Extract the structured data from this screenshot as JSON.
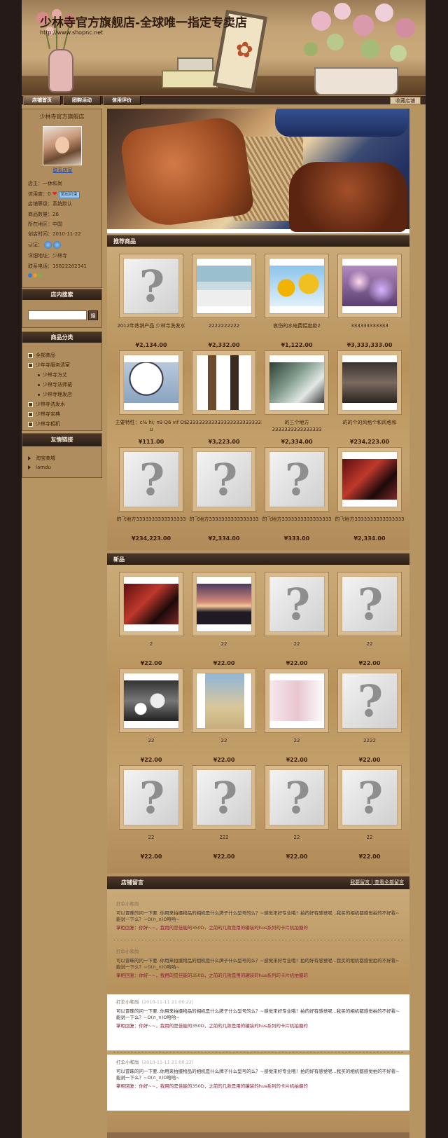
{
  "header": {
    "shop_title": "少林寺官方旗舰店-全球唯一指定专卖店",
    "shop_url": "http://www.shopnc.net"
  },
  "nav": {
    "tabs": [
      "店铺首页",
      "团购活动",
      "信用评价"
    ],
    "favorite_label": "收藏店铺"
  },
  "sidebar": {
    "shop_name": "少林寺官方旗舰店",
    "contact_link": "联系店家",
    "owner": "店主：一休和尚",
    "credit_label": "信用度：0",
    "credit_badge": "宽松约束",
    "level": "店铺等级：系统默认",
    "goods_count": "商品数量：26",
    "region": "所在地区：中国",
    "created": "创店时间：2010-11-22",
    "cert_label": "认证：",
    "address": "详细地址：少林寺",
    "phone": "联系电话：15822282341",
    "search_title": "店内搜索",
    "search_button": "搜",
    "categories_title": "商品分类",
    "categories": [
      {
        "label": "全部商品",
        "sub": false
      },
      {
        "label": "少年寺服务清室",
        "sub": false
      },
      {
        "label": "少林寺方丈",
        "sub": true
      },
      {
        "label": "少林寺法师裙",
        "sub": true
      },
      {
        "label": "少林寺理发店",
        "sub": true
      },
      {
        "label": "少林寺洗发水",
        "sub": false
      },
      {
        "label": "少林寺宝典",
        "sub": false
      },
      {
        "label": "少林寺相机",
        "sub": false
      }
    ],
    "links_title": "友情链接",
    "links": [
      "淘宝商城",
      "lamdu"
    ]
  },
  "recommended": {
    "title": "推荐商品",
    "items": [
      {
        "name": "2012年热销产品 少林寺洗发水",
        "price": "¥2,134.00",
        "img": "placeholder"
      },
      {
        "name": "2222222222",
        "price": "¥2,332.00",
        "img": "lighthouse"
      },
      {
        "name": "哀伤的水电费幅度款2",
        "price": "¥1,122.00",
        "img": "sunflower"
      },
      {
        "name": "333333333333",
        "price": "¥3,333,333.00",
        "img": "bokeh"
      },
      {
        "name": "主要特性：c% hi; n9 Q6 vif O$ u",
        "price": "¥111.00",
        "img": "clock"
      },
      {
        "name": "2333333333333333333333333",
        "price": "¥3,223.00",
        "img": "fashion"
      },
      {
        "name": "的三个地方 3333333333333333",
        "price": "¥2,334.00",
        "img": "desk"
      },
      {
        "name": "的的个的风格个和风格和",
        "price": "¥234,223.00",
        "img": "room"
      },
      {
        "name": "的飞地方3333333333333333",
        "price": "¥234,223.00",
        "img": "placeholder"
      },
      {
        "name": "的飞地方3333333333333333",
        "price": "¥2,334.00",
        "img": "placeholder"
      },
      {
        "name": "的飞地方3333333333333333",
        "price": "¥333.00",
        "img": "placeholder"
      },
      {
        "name": "的飞地方3333333333333333",
        "price": "¥2,334.00",
        "img": "party"
      }
    ]
  },
  "new_products": {
    "title": "新品",
    "items": [
      {
        "name": "2",
        "price": "¥22.00",
        "img": "party"
      },
      {
        "name": "22",
        "price": "¥22.00",
        "img": "sunset"
      },
      {
        "name": "22",
        "price": "¥22.00",
        "img": "placeholder"
      },
      {
        "name": "22",
        "price": "¥22.00",
        "img": "placeholder"
      },
      {
        "name": "22",
        "price": "¥22.00",
        "img": "bw"
      },
      {
        "name": "22",
        "price": "¥22.00",
        "img": "beach"
      },
      {
        "name": "22",
        "price": "¥22.00",
        "img": "banner"
      },
      {
        "name": "2222",
        "price": "¥22.00",
        "img": "placeholder"
      },
      {
        "name": "22",
        "price": "¥22.00",
        "img": "placeholder"
      },
      {
        "name": "222",
        "price": "¥22.00",
        "img": "placeholder"
      },
      {
        "name": "22",
        "price": "¥22.00",
        "img": "placeholder"
      },
      {
        "name": "22",
        "price": "¥22.00",
        "img": "placeholder"
      }
    ]
  },
  "messages": {
    "title": "店铺留言",
    "links": "我要留言 | 查看全部留言",
    "list": [
      {
        "user": "打伞小和尚",
        "time": "",
        "question": "可以冒昧的问一下要..你用来拍摄物品的相机是什么牌子什么型号的么？~感觉來好专业哦！拍的好有感觉呢...我买的相机都感觉拍的不好看~能说一下么？~O(∩_∩)O哈哈~",
        "reply": "掌柜回复：你好~~，我用的是佳能的350D，之前的几款是用的罐装的hus系列的卡片机拍摄的",
        "white": false
      },
      {
        "user": "打伞小和尚",
        "time": "",
        "question": "可以冒昧的问一下要..你用来拍摄物品的相机是什么牌子什么型号的么？~感觉來好专业哦！拍的好有感觉呢...我买的相机都感觉拍的不好看~能说一下么？~O(∩_∩)O哈哈~",
        "reply": "掌柜回复：你好~~，我用的是佳能的350D，之前的几款是用的罐装的hus系列的卡片机拍摄的",
        "white": false
      },
      {
        "user": "打伞小和尚",
        "time": "（2010-11-11 21:00:22）",
        "question": "可以冒昧的问一下要..你用来拍摄物品的相机是什么牌子什么型号的么？~感觉來好专业哦！拍的好有感觉呢...我买的相机都感觉拍的不好看~能说一下么？~O(∩_∩)O哈哈~",
        "reply": "掌柜回复：你好~~，我用的是佳能的350D，之前的几款是用的罐装的hus系列的卡片机拍摄的",
        "white": true
      },
      {
        "user": "打伞小和尚",
        "time": "（2010-11-11 21:00:22）",
        "question": "可以冒昧的问一下要..你用来拍摄物品的相机是什么牌子什么型号的么？~感觉來好专业哦！拍的好有感觉呢...我买的相机都感觉拍的不好看~能说一下么？~O(∩_∩)O哈哈~",
        "reply": "掌柜回复：你好~~，我用的是佳能的350D，之前的几款是用的罐装的hus系列的卡片机拍摄的",
        "white": true
      }
    ]
  }
}
